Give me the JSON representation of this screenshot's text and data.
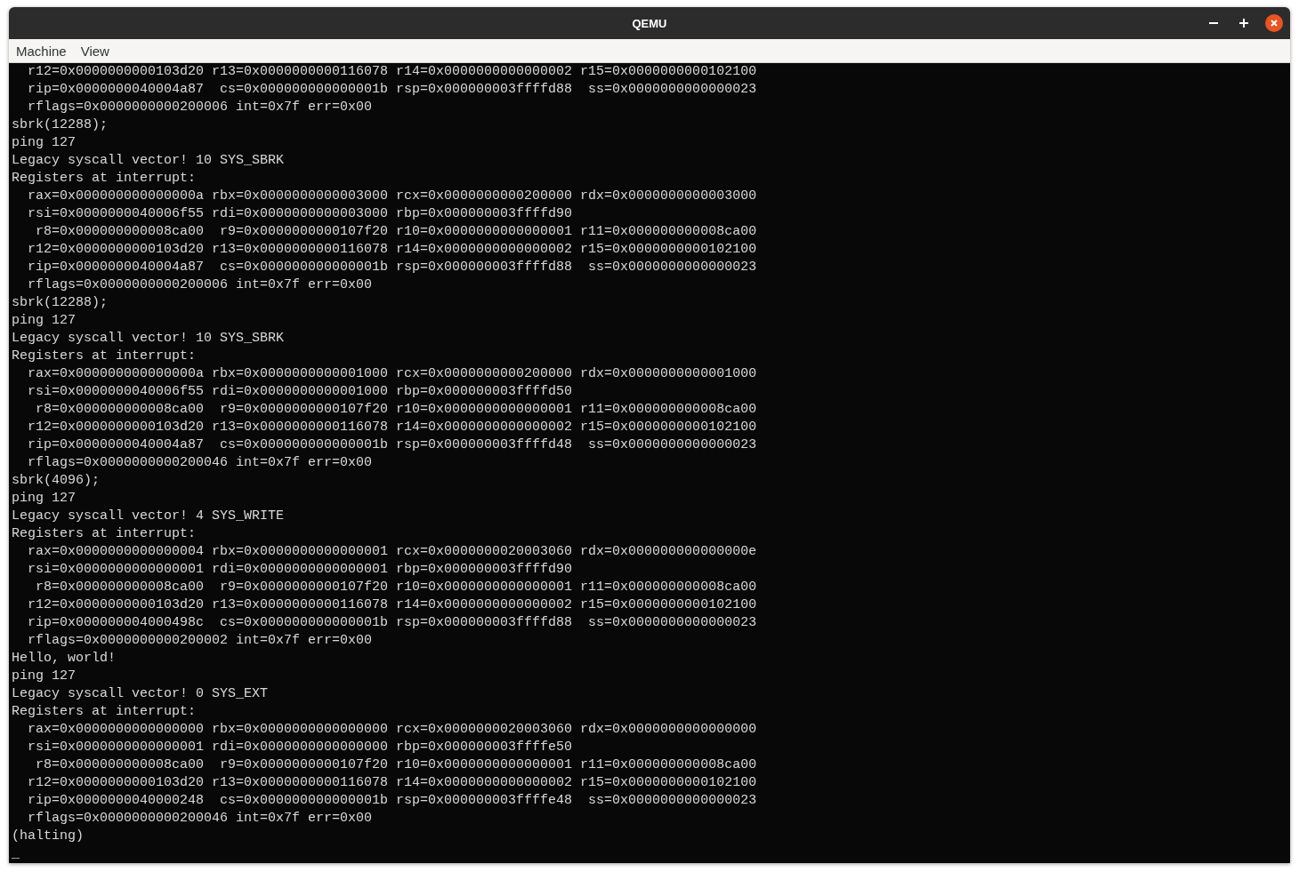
{
  "window": {
    "title": "QEMU"
  },
  "menu": [
    "Machine",
    "View"
  ],
  "console_lines": [
    "  r12=0x0000000000103d20 r13=0x0000000000116078 r14=0x0000000000000002 r15=0x0000000000102100",
    "  rip=0x0000000040004a87  cs=0x000000000000001b rsp=0x000000003ffffd88  ss=0x0000000000000023",
    "  rflags=0x0000000000200006 int=0x7f err=0x00",
    "sbrk(12288);",
    "ping 127",
    "Legacy syscall vector! 10 SYS_SBRK",
    "Registers at interrupt:",
    "  rax=0x000000000000000a rbx=0x0000000000003000 rcx=0x0000000000200000 rdx=0x0000000000003000",
    "  rsi=0x0000000040006f55 rdi=0x0000000000003000 rbp=0x000000003ffffd90",
    "   r8=0x000000000008ca00  r9=0x0000000000107f20 r10=0x0000000000000001 r11=0x000000000008ca00",
    "  r12=0x0000000000103d20 r13=0x0000000000116078 r14=0x0000000000000002 r15=0x0000000000102100",
    "  rip=0x0000000040004a87  cs=0x000000000000001b rsp=0x000000003ffffd88  ss=0x0000000000000023",
    "  rflags=0x0000000000200006 int=0x7f err=0x00",
    "sbrk(12288);",
    "ping 127",
    "Legacy syscall vector! 10 SYS_SBRK",
    "Registers at interrupt:",
    "  rax=0x000000000000000a rbx=0x0000000000001000 rcx=0x0000000000200000 rdx=0x0000000000001000",
    "  rsi=0x0000000040006f55 rdi=0x0000000000001000 rbp=0x000000003ffffd50",
    "   r8=0x000000000008ca00  r9=0x0000000000107f20 r10=0x0000000000000001 r11=0x000000000008ca00",
    "  r12=0x0000000000103d20 r13=0x0000000000116078 r14=0x0000000000000002 r15=0x0000000000102100",
    "  rip=0x0000000040004a87  cs=0x000000000000001b rsp=0x000000003ffffd48  ss=0x0000000000000023",
    "  rflags=0x0000000000200046 int=0x7f err=0x00",
    "sbrk(4096);",
    "ping 127",
    "Legacy syscall vector! 4 SYS_WRITE",
    "Registers at interrupt:",
    "  rax=0x0000000000000004 rbx=0x0000000000000001 rcx=0x0000000020003060 rdx=0x000000000000000e",
    "  rsi=0x0000000000000001 rdi=0x0000000000000001 rbp=0x000000003ffffd90",
    "   r8=0x000000000008ca00  r9=0x0000000000107f20 r10=0x0000000000000001 r11=0x000000000008ca00",
    "  r12=0x0000000000103d20 r13=0x0000000000116078 r14=0x0000000000000002 r15=0x0000000000102100",
    "  rip=0x000000004000498c  cs=0x000000000000001b rsp=0x000000003ffffd88  ss=0x0000000000000023",
    "  rflags=0x0000000000200002 int=0x7f err=0x00",
    "Hello, world!",
    "ping 127",
    "Legacy syscall vector! 0 SYS_EXT",
    "Registers at interrupt:",
    "  rax=0x0000000000000000 rbx=0x0000000000000000 rcx=0x0000000020003060 rdx=0x0000000000000000",
    "  rsi=0x0000000000000001 rdi=0x0000000000000000 rbp=0x000000003ffffe50",
    "   r8=0x000000000008ca00  r9=0x0000000000107f20 r10=0x0000000000000001 r11=0x000000000008ca00",
    "  r12=0x0000000000103d20 r13=0x0000000000116078 r14=0x0000000000000002 r15=0x0000000000102100",
    "  rip=0x0000000040000248  cs=0x000000000000001b rsp=0x000000003ffffe48  ss=0x0000000000000023",
    "  rflags=0x0000000000200046 int=0x7f err=0x00",
    "(halting)",
    "_"
  ]
}
